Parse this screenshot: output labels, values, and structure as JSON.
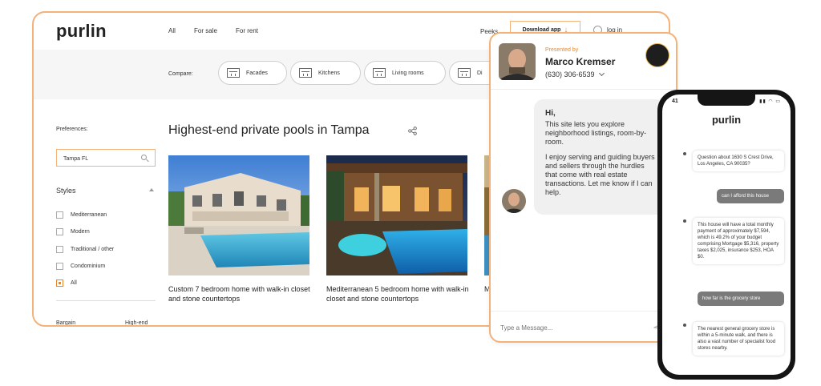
{
  "desktop": {
    "logo": "purlin",
    "nav_tabs": [
      "All",
      "For sale",
      "For rent"
    ],
    "peeks": "Peeks",
    "download_label": "Download app",
    "login_label": "log in",
    "compare_label": "Compare:",
    "compare_chips": [
      "Facades",
      "Kitchens",
      "Living rooms",
      "Di"
    ],
    "preferences_label": "Preferences:",
    "search_value": "Tampa FL",
    "styles_heading": "Styles",
    "styles": [
      {
        "label": "Mediterranean",
        "checked": false
      },
      {
        "label": "Modern",
        "checked": false
      },
      {
        "label": "Traditional / other",
        "checked": false
      },
      {
        "label": "Condominium",
        "checked": false
      },
      {
        "label": "All",
        "checked": true
      }
    ],
    "bargain_label": "Bargain",
    "highend_label": "High-end",
    "page_title": "Highest-end private pools in Tampa",
    "listings": [
      {
        "caption": "Custom 7 bedroom home with walk-in closet and stone countertops"
      },
      {
        "caption": "Mediterranean 5 bedroom home with walk-in closet and stone countertops"
      },
      {
        "caption": "M f"
      }
    ]
  },
  "agent_chat": {
    "presented_by": "Presented by",
    "agent_name": "Marco Kremser",
    "agent_phone": "(630) 306-6539",
    "bubble_greeting": "Hi,",
    "bubble_p1": "This site lets you explore neighborhood listings, room-by-room.",
    "bubble_p2": "I enjoy serving and guiding buyers and sellers through the hurdles that come with real estate transactions. Let me know if I can help.",
    "message_placeholder": "Type a Message..."
  },
  "phone": {
    "status_time": "41",
    "logo": "purlin",
    "messages": [
      {
        "dir": "in",
        "text": "Question about 1630 S Crest Drive, Los Angeles, CA 90035?"
      },
      {
        "dir": "out",
        "text": "can I afford this house"
      },
      {
        "dir": "in",
        "text": "This house will have a total monthly payment of approximately $7,594, which is 49.2% of your budget comprising Mortgage $5,316, property taxes $2,025, insurance $253, HOA $0."
      },
      {
        "dir": "out",
        "text": "how far is the grocery store"
      },
      {
        "dir": "in",
        "text": "The nearest general grocery store is within a 5-minute walk, and there is also a vast number of specialist food stores nearby."
      }
    ]
  },
  "colors": {
    "accent": "#e8872a",
    "card_border": "#f2b27a",
    "chat_bubble": "#f0f0f0",
    "phone_out_bubble": "#7a7a7a"
  },
  "icons": [
    "user-icon",
    "download-arrow-icon",
    "search-icon",
    "caret-up-icon",
    "share-icon",
    "chevron-down-icon",
    "send-icon"
  ]
}
